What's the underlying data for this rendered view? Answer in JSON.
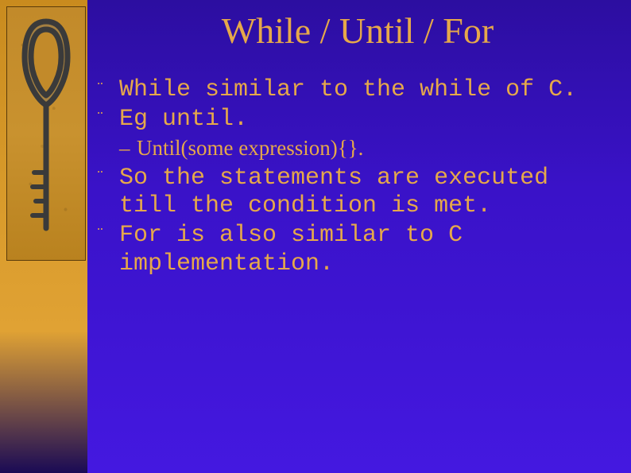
{
  "title": "While / Until / For",
  "bullets": {
    "b1": "While similar to the while of C.",
    "b2": "Eg until.",
    "sub1": "Until(some expression){}.",
    "b3": "So the statements are executed till the condition is met.",
    "b4": "For is also similar to C implementation."
  },
  "markers": {
    "diamond": "¨",
    "dash": "–"
  },
  "theme": {
    "accent": "#e6a84a",
    "bg_top": "#2c0ea0",
    "bg_bottom": "#4418e0",
    "side_gold": "#c98b1e"
  }
}
